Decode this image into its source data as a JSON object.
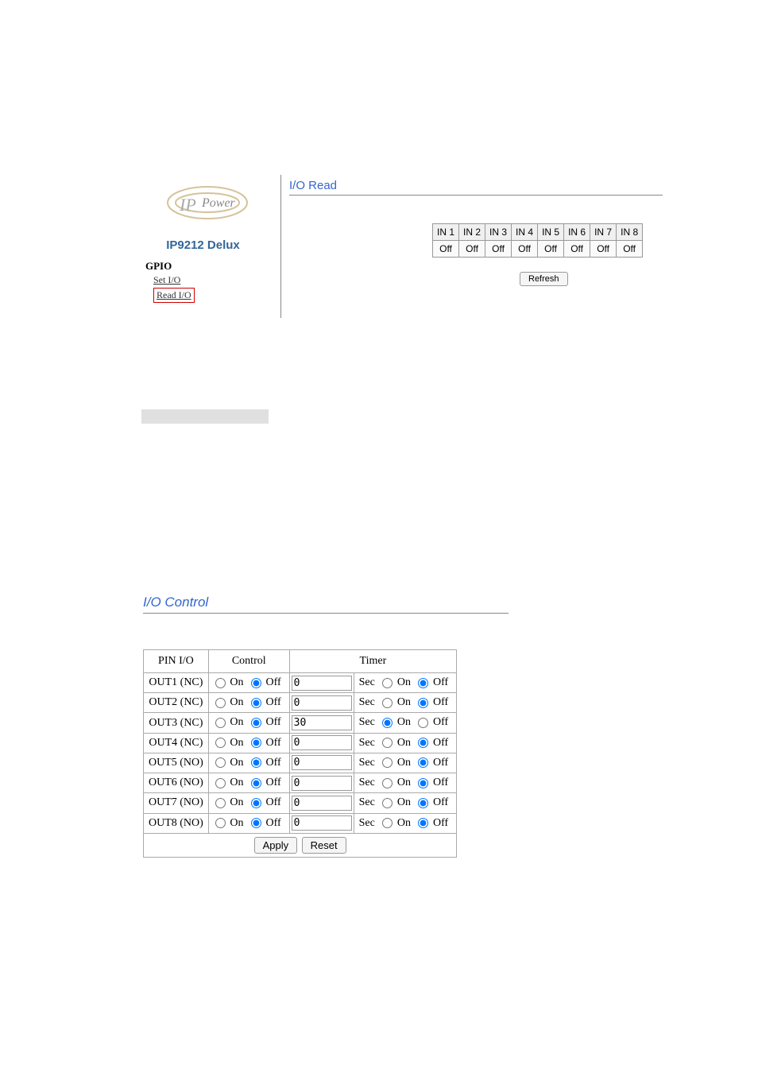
{
  "sidebar": {
    "product_name": "IP9212 Delux",
    "nav_header": "GPIO",
    "nav_items": [
      {
        "label": "Set I/O",
        "active": false
      },
      {
        "label": "Read I/O",
        "active": true
      }
    ]
  },
  "io_read": {
    "title": "I/O Read",
    "headers": [
      "IN 1",
      "IN 2",
      "IN 3",
      "IN 4",
      "IN 5",
      "IN 6",
      "IN 7",
      "IN 8"
    ],
    "values": [
      "Off",
      "Off",
      "Off",
      "Off",
      "Off",
      "Off",
      "Off",
      "Off"
    ],
    "refresh_label": "Refresh"
  },
  "io_control": {
    "title": "I/O Control",
    "columns": [
      "PIN I/O",
      "Control",
      "Timer"
    ],
    "on_label": "On",
    "off_label": "Off",
    "sec_label": "Sec",
    "apply_label": "Apply",
    "reset_label": "Reset",
    "rows": [
      {
        "pin": "OUT1 (NC)",
        "control": "Off",
        "timer_val": "0",
        "timer_sel": "Off"
      },
      {
        "pin": "OUT2 (NC)",
        "control": "Off",
        "timer_val": "0",
        "timer_sel": "Off"
      },
      {
        "pin": "OUT3 (NC)",
        "control": "Off",
        "timer_val": "30",
        "timer_sel": "On"
      },
      {
        "pin": "OUT4 (NC)",
        "control": "Off",
        "timer_val": "0",
        "timer_sel": "Off"
      },
      {
        "pin": "OUT5 (NO)",
        "control": "Off",
        "timer_val": "0",
        "timer_sel": "Off"
      },
      {
        "pin": "OUT6 (NO)",
        "control": "Off",
        "timer_val": "0",
        "timer_sel": "Off"
      },
      {
        "pin": "OUT7 (NO)",
        "control": "Off",
        "timer_val": "0",
        "timer_sel": "Off"
      },
      {
        "pin": "OUT8 (NO)",
        "control": "Off",
        "timer_val": "0",
        "timer_sel": "Off"
      }
    ]
  }
}
